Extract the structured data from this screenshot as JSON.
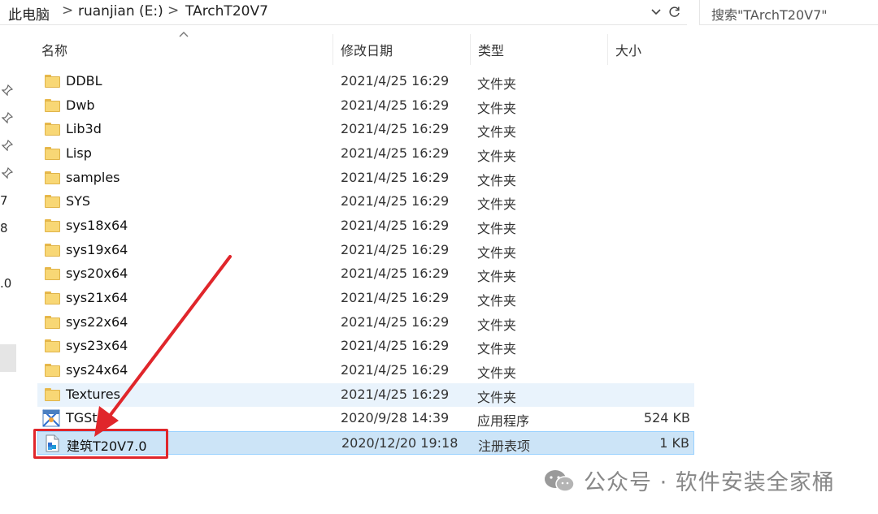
{
  "address_bar": {
    "crumbs": [
      "此电脑",
      "ruanjian (E:)",
      "TArchT20V7"
    ],
    "separator": ">",
    "dropdown_icon": "chevron-down-icon",
    "refresh_icon": "refresh-icon"
  },
  "search": {
    "placeholder": "搜索\"TArchT20V7\""
  },
  "nav": {
    "numbers": [
      "7",
      "8",
      ".0"
    ],
    "pin_icon": "pin-icon"
  },
  "columns": {
    "name": "名称",
    "date": "修改日期",
    "type": "类型",
    "size": "大小"
  },
  "files": [
    {
      "name": "DDBL",
      "date": "2021/4/25 16:29",
      "type": "文件夹",
      "size": "",
      "icon": "folder-icon"
    },
    {
      "name": "Dwb",
      "date": "2021/4/25 16:29",
      "type": "文件夹",
      "size": "",
      "icon": "folder-icon"
    },
    {
      "name": "Lib3d",
      "date": "2021/4/25 16:29",
      "type": "文件夹",
      "size": "",
      "icon": "folder-icon"
    },
    {
      "name": "Lisp",
      "date": "2021/4/25 16:29",
      "type": "文件夹",
      "size": "",
      "icon": "folder-icon"
    },
    {
      "name": "samples",
      "date": "2021/4/25 16:29",
      "type": "文件夹",
      "size": "",
      "icon": "folder-icon"
    },
    {
      "name": "SYS",
      "date": "2021/4/25 16:29",
      "type": "文件夹",
      "size": "",
      "icon": "folder-icon"
    },
    {
      "name": "sys18x64",
      "date": "2021/4/25 16:29",
      "type": "文件夹",
      "size": "",
      "icon": "folder-icon"
    },
    {
      "name": "sys19x64",
      "date": "2021/4/25 16:29",
      "type": "文件夹",
      "size": "",
      "icon": "folder-icon"
    },
    {
      "name": "sys20x64",
      "date": "2021/4/25 16:29",
      "type": "文件夹",
      "size": "",
      "icon": "folder-icon"
    },
    {
      "name": "sys21x64",
      "date": "2021/4/25 16:29",
      "type": "文件夹",
      "size": "",
      "icon": "folder-icon"
    },
    {
      "name": "sys22x64",
      "date": "2021/4/25 16:29",
      "type": "文件夹",
      "size": "",
      "icon": "folder-icon"
    },
    {
      "name": "sys23x64",
      "date": "2021/4/25 16:29",
      "type": "文件夹",
      "size": "",
      "icon": "folder-icon"
    },
    {
      "name": "sys24x64",
      "date": "2021/4/25 16:29",
      "type": "文件夹",
      "size": "",
      "icon": "folder-icon"
    },
    {
      "name": "Textures",
      "date": "2021/4/25 16:29",
      "type": "文件夹",
      "size": "",
      "icon": "folder-icon"
    },
    {
      "name": "TGSt",
      "date": "2020/9/28 14:39",
      "type": "应用程序",
      "size": "524 KB",
      "icon": "app-icon"
    },
    {
      "name": "建筑T20V7.0",
      "date": "2020/12/20 19:18",
      "type": "注册表项",
      "size": "1 KB",
      "icon": "registry-file-icon"
    }
  ],
  "watermark": {
    "text": "公众号 · 软件安装全家桶",
    "icon": "wechat-logo-icon"
  },
  "annotation": {
    "color": "#e0262b"
  }
}
